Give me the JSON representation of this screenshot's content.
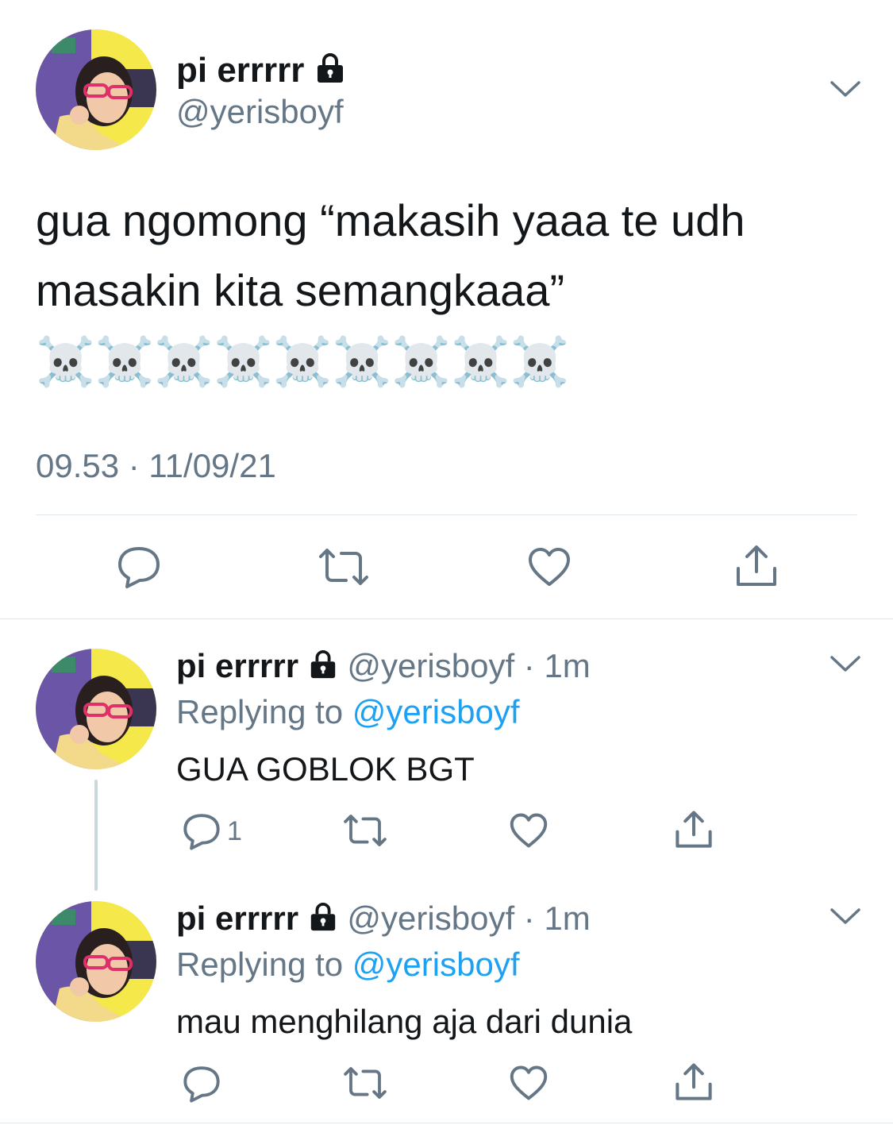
{
  "main_tweet": {
    "display_name": "pi errrrr",
    "handle": "@yerisboyf",
    "text_line1": "gua ngomong “makasih yaaa te udh",
    "text_line2": "masakin kita semangkaaa”",
    "emoji_line": "☠️☠️☠️☠️☠️☠️☠️☠️☠️",
    "timestamp": "09.53 · 11/09/21",
    "actions": [
      "reply-icon",
      "retweet-icon",
      "like-icon",
      "share-icon"
    ]
  },
  "replies": [
    {
      "display_name": "pi errrrr",
      "handle_time": "@yerisboyf · 1m",
      "replying_prefix": "Replying to",
      "replying_to": "@yerisboyf",
      "text": "GUA GOBLOK BGT",
      "reply_count": "1"
    },
    {
      "display_name": "pi errrrr",
      "handle_time": "@yerisboyf · 1m",
      "replying_prefix": "Replying to",
      "replying_to": "@yerisboyf",
      "text": "mau menghilang aja dari dunia",
      "reply_count": ""
    }
  ],
  "colors": {
    "text": "#14171a",
    "secondary": "#657786",
    "accent": "#1da1f2",
    "divider": "#e1e8ed",
    "icon": "#657786"
  }
}
